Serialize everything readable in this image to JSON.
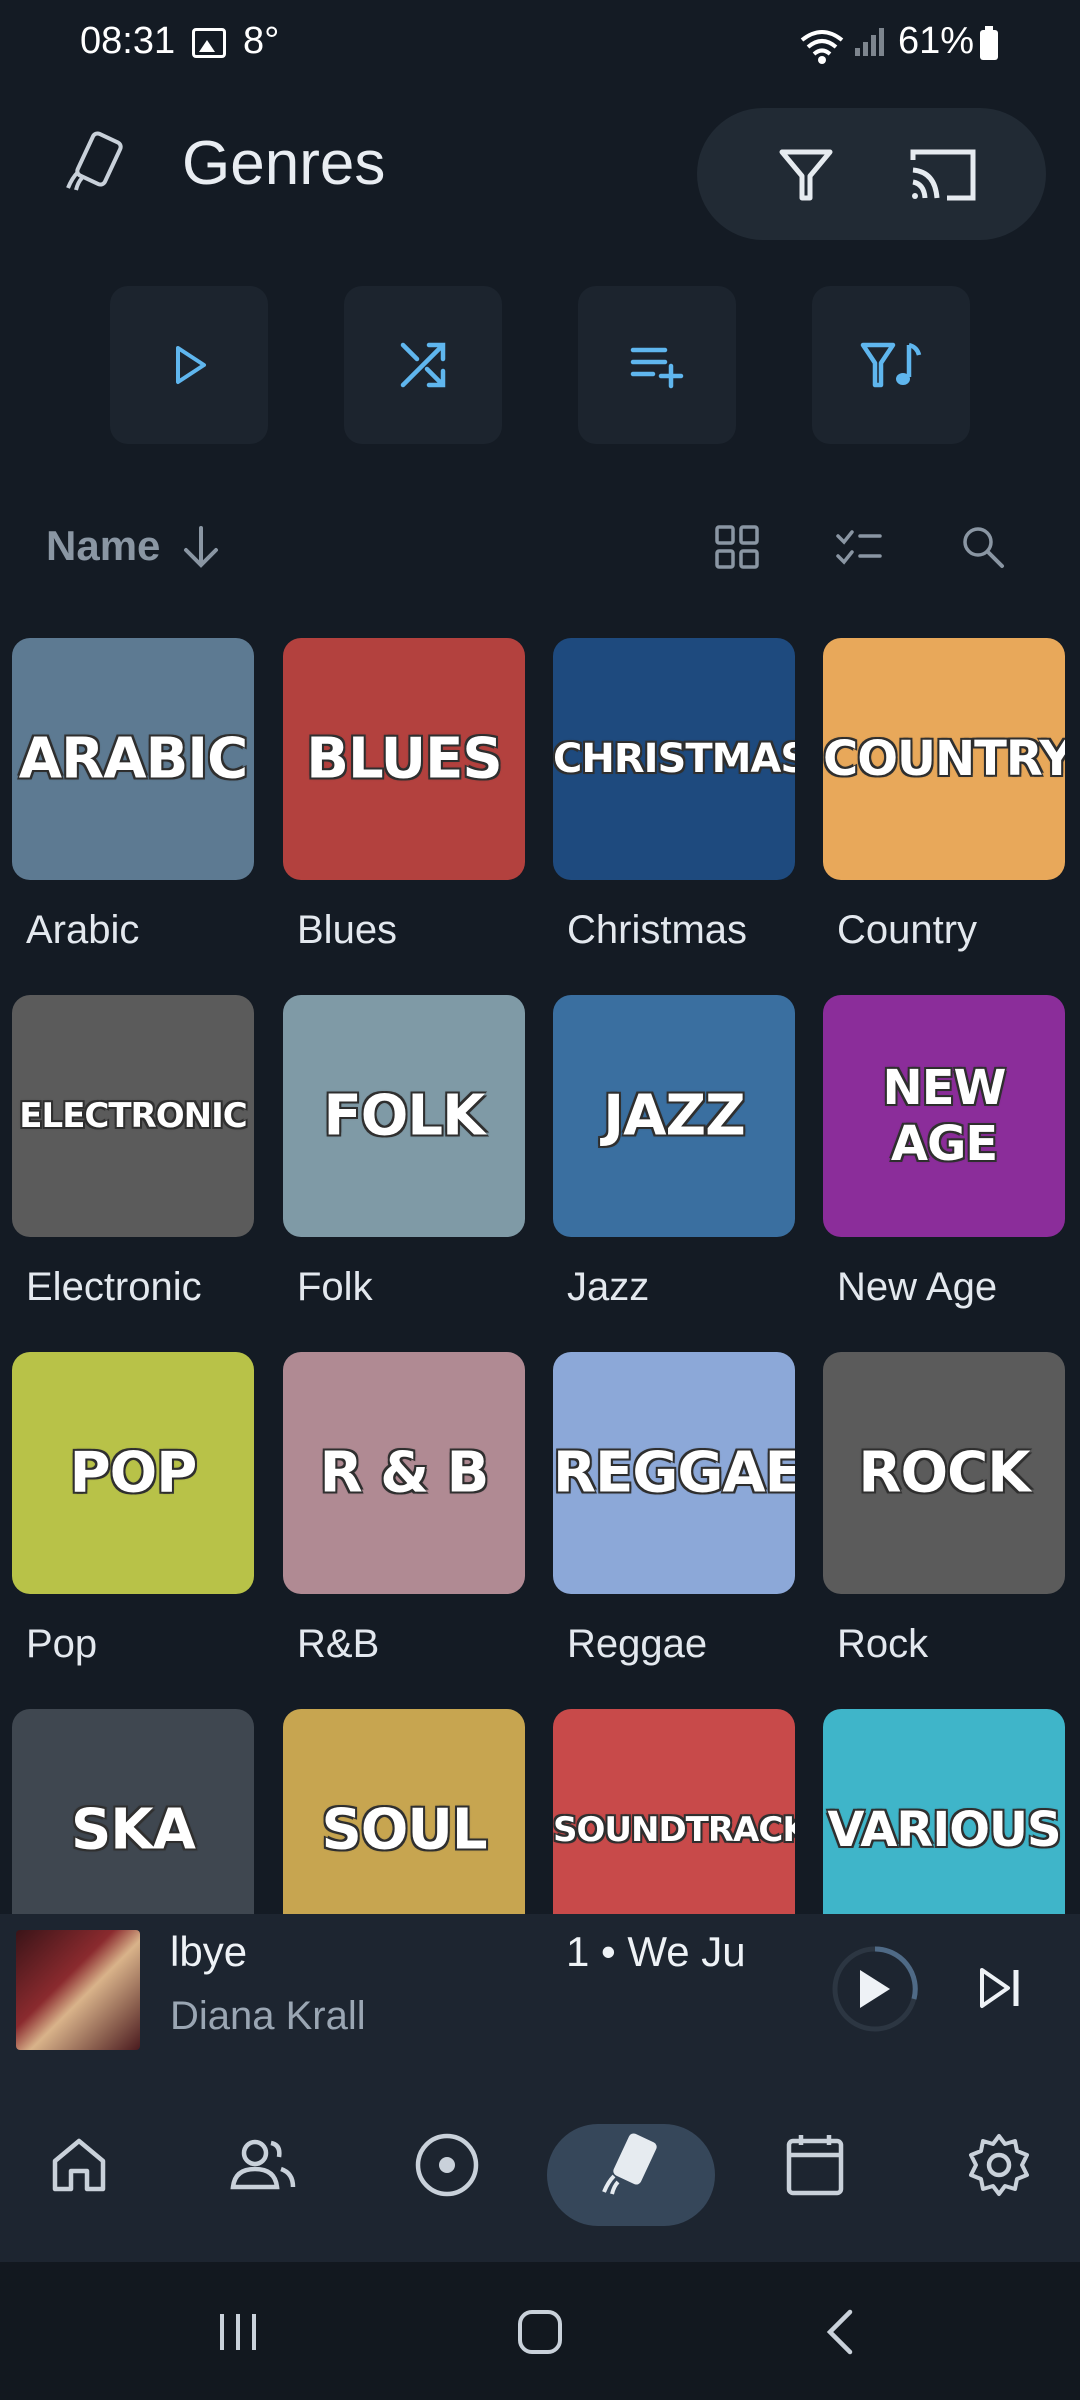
{
  "status": {
    "time": "08:31",
    "temp": "8°",
    "battery": "61%"
  },
  "header": {
    "title": "Genres"
  },
  "actions": [
    "play",
    "shuffle",
    "add-to-queue",
    "filter-music"
  ],
  "sort": {
    "label": "Name"
  },
  "tiles": [
    {
      "art": "ARABIC",
      "name": "Arabic",
      "bg": "#5d7a92"
    },
    {
      "art": "BLUES",
      "name": "Blues",
      "bg": "#b3413e"
    },
    {
      "art": "CHRISTMAS",
      "name": "Christmas",
      "bg": "#1e4a7e"
    },
    {
      "art": "COUNTRY",
      "name": "Country",
      "bg": "#e8a85a"
    },
    {
      "art": "ELECTRONIC",
      "name": "Electronic",
      "bg": "#5b5b5b"
    },
    {
      "art": "FOLK",
      "name": "Folk",
      "bg": "#7f9aa6"
    },
    {
      "art": "JAZZ",
      "name": "Jazz",
      "bg": "#3a6fa0"
    },
    {
      "art": "NEW AGE",
      "name": "New Age",
      "bg": "#8b2d9a"
    },
    {
      "art": "POP",
      "name": "Pop",
      "bg": "#b8c248"
    },
    {
      "art": "R & B",
      "name": "R&B",
      "bg": "#b08a93"
    },
    {
      "art": "REGGAE",
      "name": "Reggae",
      "bg": "#8ca8d8"
    },
    {
      "art": "ROCK",
      "name": "Rock",
      "bg": "#5b5b5b"
    },
    {
      "art": "SKA",
      "name": "",
      "bg": "#3f4750"
    },
    {
      "art": "SOUL",
      "name": "",
      "bg": "#c7a550"
    },
    {
      "art": "SOUNDTRACK",
      "name": "",
      "bg": "#c84a4a"
    },
    {
      "art": "VARIOUS",
      "name": "",
      "bg": "#3fb5c9"
    }
  ],
  "nowplaying": {
    "title": "lbye",
    "track": "1 • We Ju",
    "artist": "Diana Krall"
  },
  "colors": {
    "accent": "#5fb6ee",
    "background": "#141b24"
  }
}
